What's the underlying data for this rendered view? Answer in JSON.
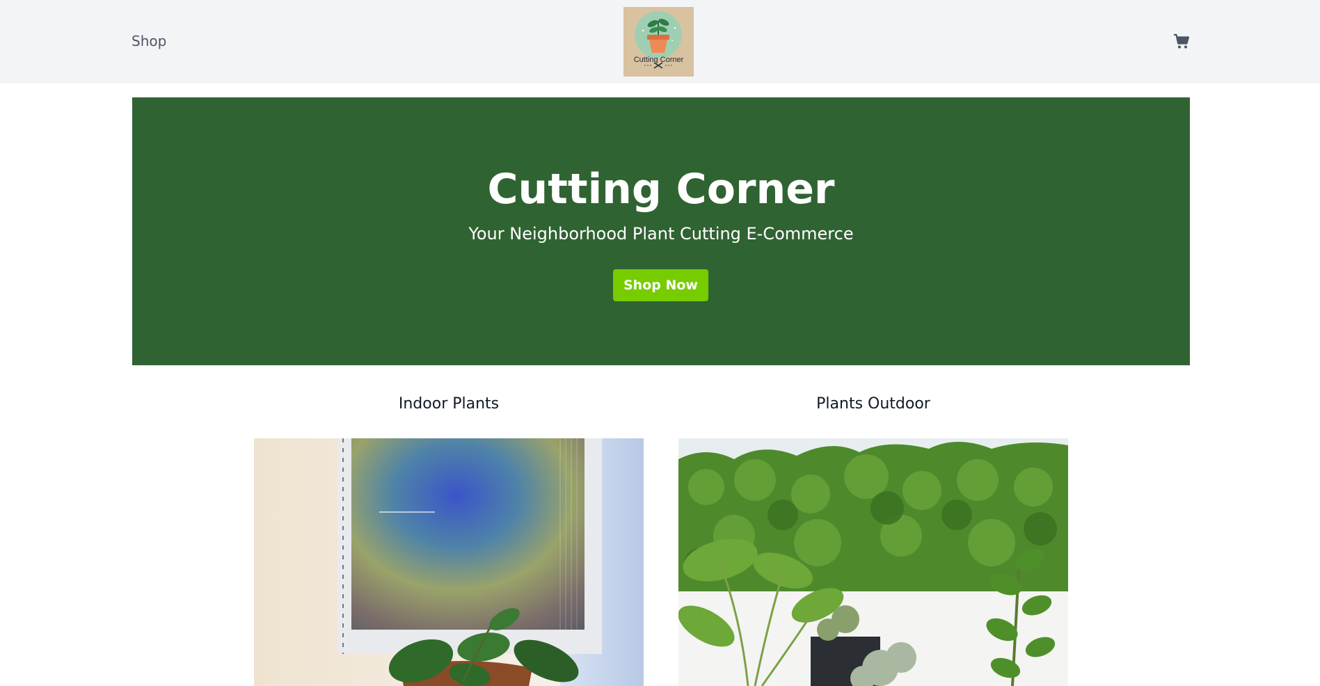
{
  "header": {
    "nav_shop_label": "Shop",
    "logo_text": "Cutting Corner",
    "cart_icon": "cart-icon"
  },
  "hero": {
    "title": "Cutting Corner",
    "subtitle": "Your Neighborhood Plant Cutting E-Commerce",
    "button_label": "Shop Now"
  },
  "categories": [
    {
      "title": "Indoor Plants",
      "image": "indoor-plant-photo"
    },
    {
      "title": "Plants Outdoor",
      "image": "outdoor-plants-photo"
    }
  ],
  "colors": {
    "header_bg": "#f3f4f6",
    "hero_bg": "#306332",
    "button_bg": "#77cc00",
    "text_dark": "#111827",
    "nav_text": "#4b5563"
  }
}
